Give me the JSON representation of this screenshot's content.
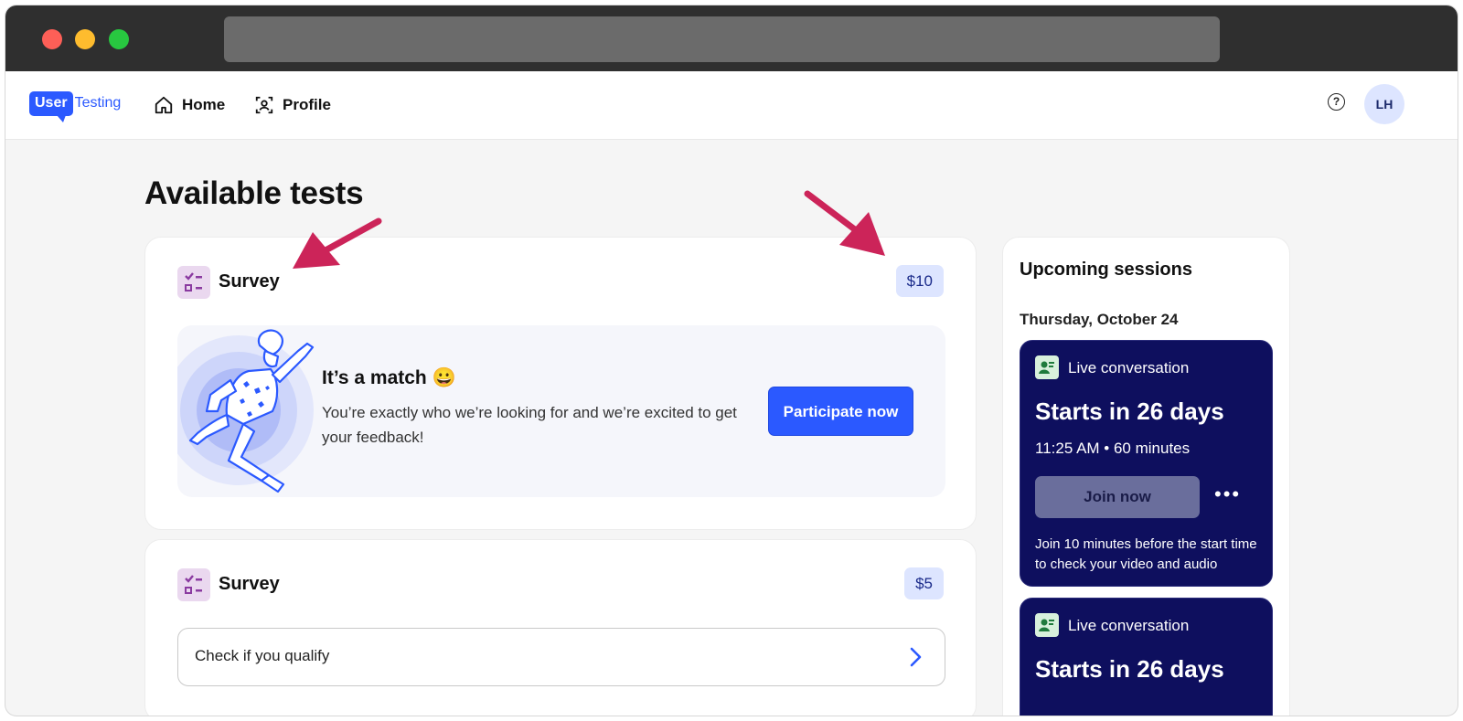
{
  "nav": {
    "logo_user": "User",
    "logo_testing": "Testing",
    "home_label": "Home",
    "profile_label": "Profile",
    "help_symbol": "?",
    "avatar_initials": "LH"
  },
  "page_title": "Available tests",
  "tests": [
    {
      "title": "Survey",
      "price": "$10",
      "match_title": "It’s a match 😀",
      "match_desc": "You’re exactly who we’re looking for and we’re excited to get your feedback!",
      "action_label": "Participate now"
    },
    {
      "title": "Survey",
      "price": "$5",
      "action_label": "Check if you qualify"
    }
  ],
  "upcoming": {
    "title": "Upcoming sessions",
    "date": "Thursday, October 24",
    "sessions": [
      {
        "type": "Live conversation",
        "starts": "Starts in 26 days",
        "time": "11:25 AM • 60 minutes",
        "join_label": "Join now",
        "more": "•••",
        "note": "Join 10 minutes before the start time to check your video and audio"
      },
      {
        "type": "Live conversation",
        "starts": "Starts in 26 days"
      }
    ]
  },
  "colors": {
    "brand": "#2b59ff",
    "session_bg": "#0e0f5e",
    "price_bg": "#dde5ff",
    "annotation_arrow": "#cc2459"
  },
  "icons": [
    "home-icon",
    "profile-icon",
    "help-icon",
    "survey-icon",
    "chevron-right-icon",
    "conversation-icon",
    "more-icon",
    "annotation-arrow"
  ]
}
